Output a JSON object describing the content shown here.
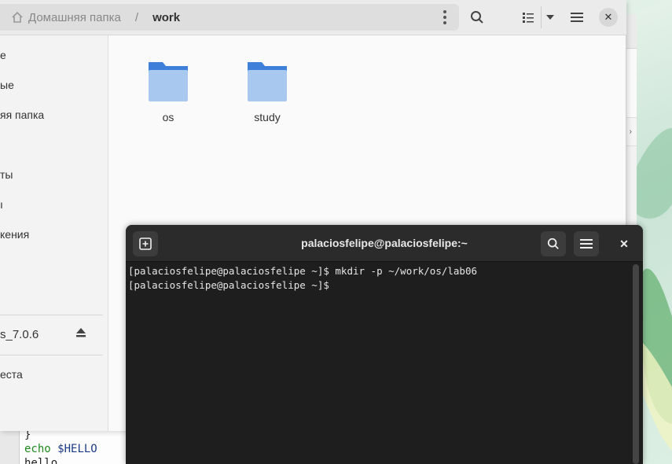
{
  "file_manager": {
    "path": {
      "home_label": "Домашняя папка",
      "separator": "/",
      "current": "work"
    },
    "sidebar": {
      "items": [
        "е",
        "ые",
        "яя папка",
        "ты",
        "ı",
        "кения"
      ],
      "device": "s_7.0.6",
      "other": "еста"
    },
    "folders": [
      {
        "name": "os"
      },
      {
        "name": "study"
      }
    ]
  },
  "terminal": {
    "title": "palaciosfelipe@palaciosfelipe:~",
    "lines": [
      "[palaciosfelipe@palaciosfelipe ~]$ mkdir -p ~/work/os/lab06",
      "[palaciosfelipe@palaciosfelipe ~]$ "
    ]
  },
  "editor": {
    "lines": [
      "}",
      "echo $HELLO",
      "hello"
    ]
  },
  "colors": {
    "folder_blue": "#3d7fd9",
    "terminal_bg": "#1e1e1e",
    "accent_green": "#1d8a1d"
  }
}
